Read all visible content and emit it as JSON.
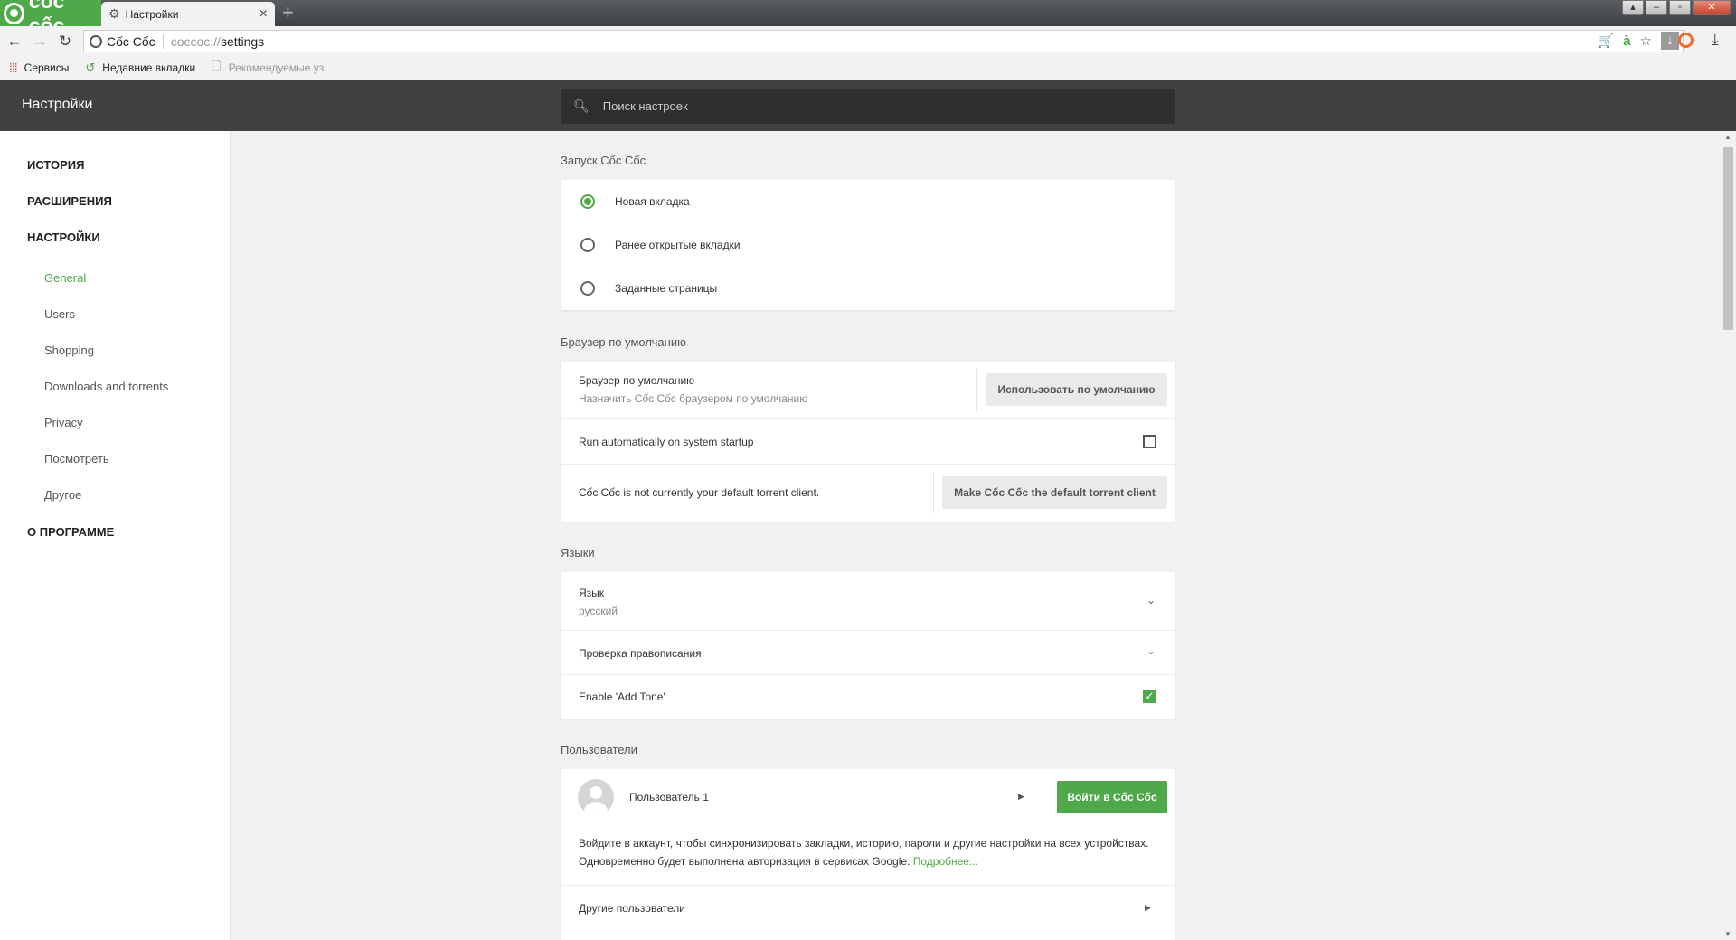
{
  "browser": {
    "brand_label": "cốc cốc",
    "tab_title": "Настройки",
    "new_tab_glyph": "+",
    "omnibox_site": "Cốc Cốc",
    "omnibox_scheme": "coccoc://",
    "omnibox_path": "settings",
    "bookmarks": [
      {
        "label": "Сервисы",
        "icon": "apps-icon"
      },
      {
        "label": "Недавние вкладки",
        "icon": "recent-tabs-icon"
      },
      {
        "label": "Рекомендуемые уз",
        "icon": "page-icon"
      }
    ]
  },
  "header": {
    "title": "Настройки",
    "search_placeholder": "Поиск настроек"
  },
  "sidebar": {
    "sections": {
      "history": "ИСТОРИЯ",
      "extensions": "РАСШИРЕНИЯ",
      "settings": "НАСТРОЙКИ",
      "about": "О ПРОГРАММЕ"
    },
    "items": [
      "General",
      "Users",
      "Shopping",
      "Downloads and torrents",
      "Privacy",
      "Посмотреть",
      "Другое"
    ],
    "active_item": "General"
  },
  "startup": {
    "title": "Запуск Cốc Cốc",
    "options": [
      "Новая вкладка",
      "Ранее открытые вкладки",
      "Заданные страницы"
    ],
    "selected": "Новая вкладка"
  },
  "default_browser": {
    "title": "Браузер по умолчанию",
    "label": "Браузер по умолчанию",
    "sub": "Назначить Cốc Cốc браузером по умолчанию",
    "button": "Использовать по умолчанию",
    "startup_label": "Run automatically on system startup",
    "startup_checked": false,
    "torrent_text": "Cốc Cốc is not currently your default torrent client.",
    "torrent_button": "Make Cốc Cốc the default torrent client"
  },
  "languages": {
    "title": "Языки",
    "language_label": "Язык",
    "language_value": "русский",
    "spellcheck_label": "Проверка правописания",
    "add_tone_label": "Enable 'Add Tone'",
    "add_tone_checked": true
  },
  "users": {
    "title": "Пользователи",
    "user_name": "Пользователь 1",
    "signin_button": "Войти в Cốc Cốc",
    "description": "Войдите в аккаунт, чтобы синхронизировать закладки, историю, пароли и другие настройки на всех устройствах. Одновременно будет выполнена авторизация в сервисах Google.",
    "learn_more": "Подробнее...",
    "other_users": "Другие пользователи"
  },
  "colors": {
    "accent": "#4fa84a",
    "header_bg": "#414141",
    "search_bg": "#2f2f2f",
    "page_bg": "#f1f1f1"
  }
}
